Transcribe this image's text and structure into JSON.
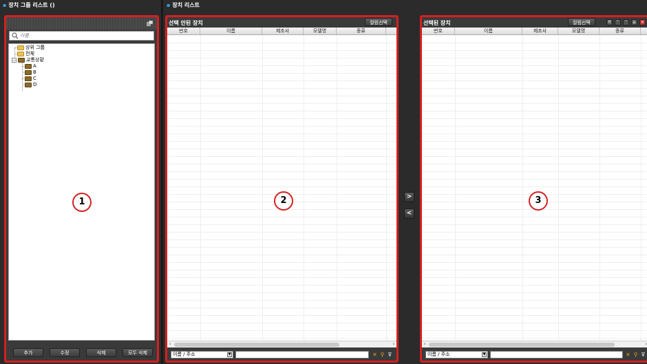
{
  "left_section": {
    "title": "장치 그룹 리스트 ()",
    "search_placeholder": "이름",
    "tree": [
      {
        "label": "상위 그룹",
        "level": 1,
        "folder": "light"
      },
      {
        "label": "전체",
        "level": 1,
        "folder": "light"
      },
      {
        "label": "교통상황",
        "level": 1,
        "folder": "dark",
        "expander": "−"
      },
      {
        "label": "A",
        "level": 2,
        "folder": "dark"
      },
      {
        "label": "B",
        "level": 2,
        "folder": "dark"
      },
      {
        "label": "C",
        "level": 2,
        "folder": "dark"
      },
      {
        "label": "D",
        "level": 2,
        "folder": "dark"
      }
    ],
    "buttons": [
      "추가",
      "수정",
      "삭제",
      "모두 삭제"
    ],
    "marker": "1"
  },
  "right_section": {
    "title": "장치 리스트"
  },
  "unselected_panel": {
    "title": "선택 안된 장치",
    "column_select_label": "컬럼선택",
    "columns": [
      "번호",
      "이름",
      "제조사",
      "모델명",
      "종류"
    ],
    "filter_select": "이름 / 주소",
    "marker": "2"
  },
  "selected_panel": {
    "title": "선택된 장치",
    "column_select_label": "컬럼선택",
    "columns": [
      "번호",
      "이름",
      "제조사",
      "모델명",
      "종류"
    ],
    "filter_select": "이름 / 주소",
    "marker": "3"
  },
  "transfer": {
    "move_right": ">",
    "move_left": "<"
  },
  "colors": {
    "highlight_border": "#d42020",
    "background": "#2b2b2b",
    "accent": "#3a9adf"
  }
}
